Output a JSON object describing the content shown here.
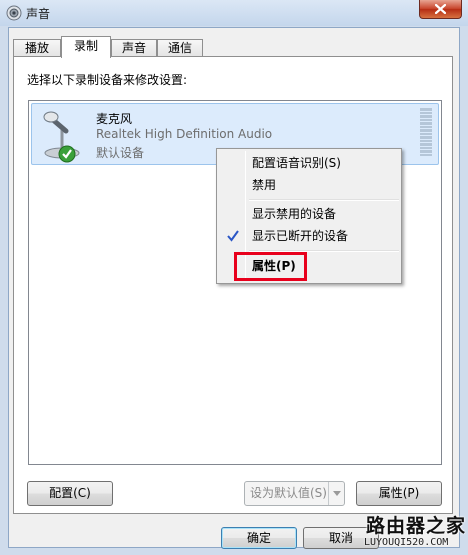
{
  "window": {
    "title": "声音"
  },
  "tabs": [
    {
      "label": "播放"
    },
    {
      "label": "录制"
    },
    {
      "label": "声音"
    },
    {
      "label": "通信"
    }
  ],
  "panel": {
    "instruction": "选择以下录制设备来修改设置:"
  },
  "device": {
    "name": "麦克风",
    "driver": "Realtek High Definition Audio",
    "status": "默认设备",
    "level_percent": 0
  },
  "context_menu": {
    "items": [
      {
        "label": "配置语音识别(S)"
      },
      {
        "label": "禁用"
      },
      {
        "label": "显示禁用的设备"
      },
      {
        "label": "显示已断开的设备",
        "checked": true
      },
      {
        "label": "属性(P)"
      }
    ]
  },
  "buttons": {
    "configure": "配置(C)",
    "set_default": "设为默认值(S)",
    "properties": "属性(P)",
    "ok": "确定",
    "cancel": "取消"
  },
  "watermark": {
    "cn": "路由器之家",
    "en": "LUYOUQI520.COM"
  },
  "colors": {
    "highlight": "#e8001c",
    "selection": "#dcebfc",
    "check": "#2a56c6"
  }
}
